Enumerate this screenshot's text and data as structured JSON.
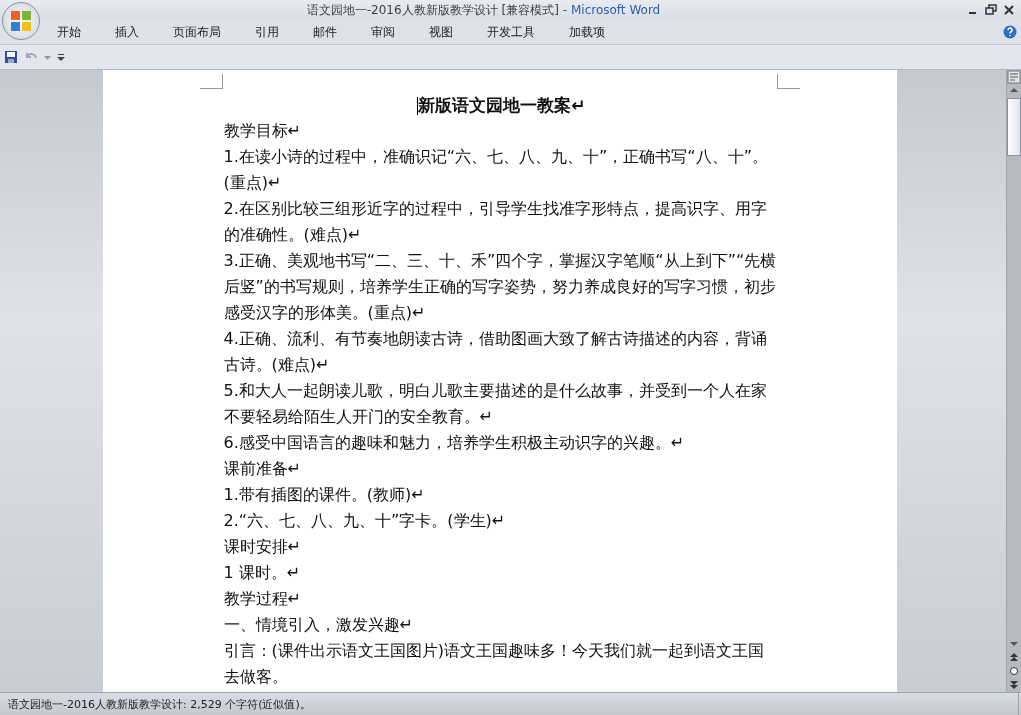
{
  "window": {
    "title": "语文园地一-2016人教新版教学设计 [兼容模式]",
    "app_name": "- Microsoft Word"
  },
  "ribbon_tabs": [
    {
      "label": "开始"
    },
    {
      "label": "插入"
    },
    {
      "label": "页面布局"
    },
    {
      "label": "引用"
    },
    {
      "label": "邮件"
    },
    {
      "label": "审阅"
    },
    {
      "label": "视图"
    },
    {
      "label": "开发工具"
    },
    {
      "label": "加载项"
    }
  ],
  "quick_access": {
    "undo_disabled": true
  },
  "document": {
    "title": "新版语文园地一教案↵",
    "paragraphs": [
      "教学目标↵",
      "1.在读小诗的过程中，准确识记“六、七、八、九、十”，正确书写“八、十”。(重点)↵",
      "2.在区别比较三组形近字的过程中，引导学生找准字形特点，提高识字、用字的准确性。(难点)↵",
      "3.正确、美观地书写“二、三、十、禾”四个字，掌握汉字笔顺“从上到下”“先横后竖”的书写规则，培养学生正确的写字姿势，努力养成良好的写字习惯，初步感受汉字的形体美。(重点)↵",
      "4.正确、流利、有节奏地朗读古诗，借助图画大致了解古诗描述的内容，背诵古诗。(难点)↵",
      "5.和大人一起朗读儿歌，明白儿歌主要描述的是什么故事，并受到一个人在家不要轻易给陌生人开门的安全教育。↵",
      "6.感受中国语言的趣味和魅力，培养学生积极主动识字的兴趣。↵",
      "课前准备↵",
      "1.带有插图的课件。(教师)↵",
      "2.“六、七、八、九、十”字卡。(学生)↵",
      "课时安排↵",
      "1 课时。↵",
      "教学过程↵",
      "一、情境引入，激发兴趣↵",
      "引言：(课件出示语文王国图片)语文王国趣味多！今天我们就一起到语文王国去做客。"
    ]
  },
  "status_bar": {
    "text": "语文园地一-2016人教新版教学设计: 2,529 个字符(近似值)。"
  }
}
